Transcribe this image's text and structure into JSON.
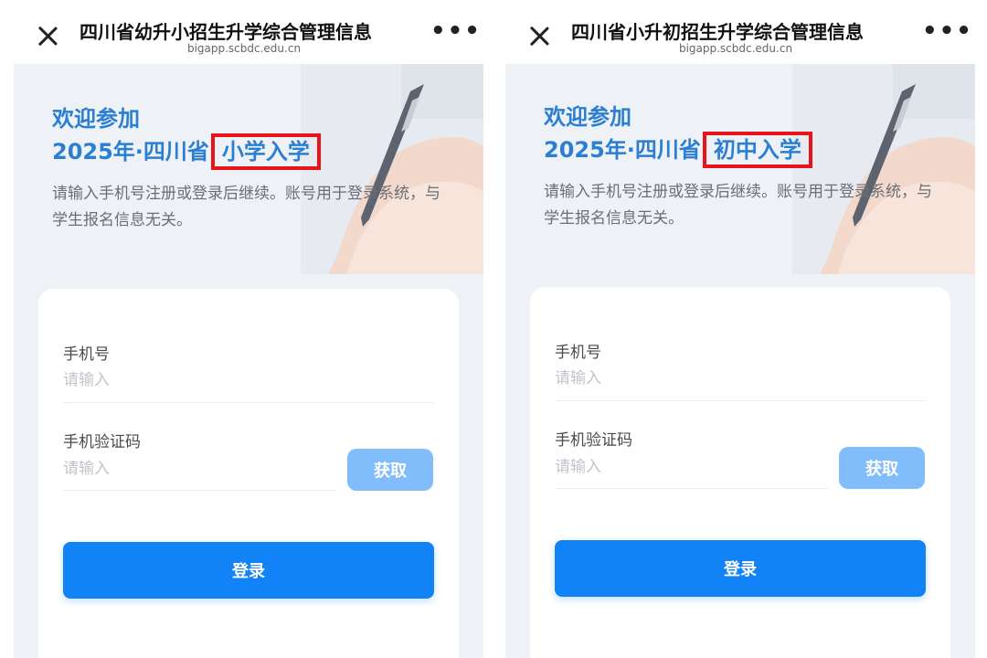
{
  "colors": {
    "accent": "#1283f7",
    "heading": "#2b7fd2",
    "highlight_border": "#e8141a",
    "get_button": "#82bdfb"
  },
  "panels": [
    {
      "title": "四川省幼升小招生升学综合管理信息",
      "url": "bigapp.scbdc.edu.cn",
      "welcome": "欢迎参加",
      "year_prefix": "2025年·四川省",
      "highlight": "小学入学",
      "description": "请输入手机号注册或登录后继续。账号用于登录系统，与学生报名信息无关。",
      "phone_label": "手机号",
      "phone_placeholder": "请输入",
      "code_label": "手机验证码",
      "code_placeholder": "请输入",
      "get_code_label": "获取",
      "login_label": "登录"
    },
    {
      "title": "四川省小升初招生升学综合管理信息",
      "url": "bigapp.scbdc.edu.cn",
      "welcome": "欢迎参加",
      "year_prefix": "2025年·四川省",
      "highlight": "初中入学",
      "description": "请输入手机号注册或登录后继续。账号用于登录系统，与学生报名信息无关。",
      "phone_label": "手机号",
      "phone_placeholder": "请输入",
      "code_label": "手机验证码",
      "code_placeholder": "请输入",
      "get_code_label": "获取",
      "login_label": "登录"
    }
  ]
}
